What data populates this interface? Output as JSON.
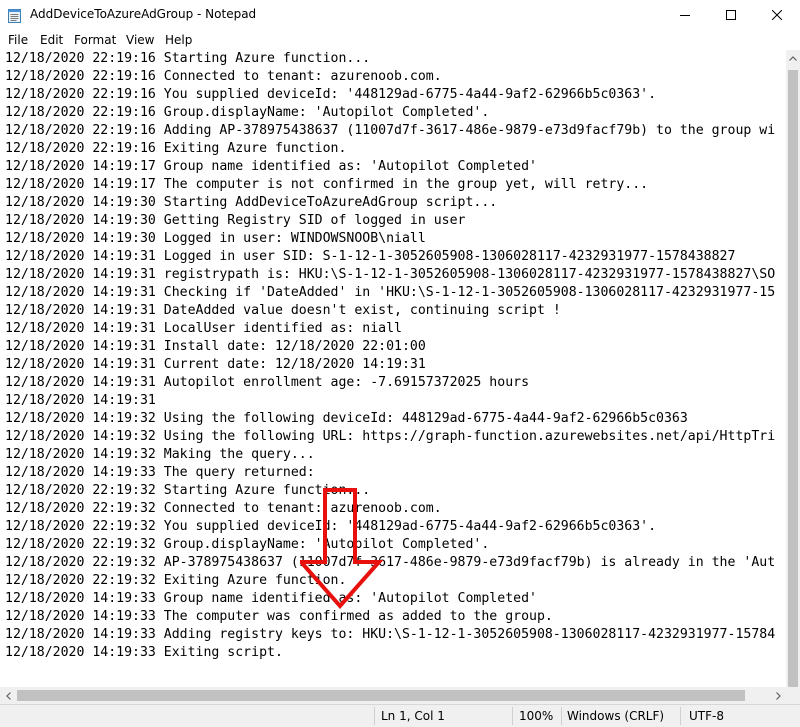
{
  "window": {
    "title": "AddDeviceToAzureAdGroup - Notepad",
    "icon": "notepad-icon",
    "controls": [
      "minimize-icon",
      "maximize-icon",
      "close-icon"
    ]
  },
  "menu": {
    "items": [
      "File",
      "Edit",
      "Format",
      "View",
      "Help"
    ]
  },
  "editor": {
    "lines": [
      "12/18/2020 22:19:16 Starting Azure function...",
      "12/18/2020 22:19:16 Connected to tenant: azurenoob.com.",
      "12/18/2020 22:19:16 You supplied deviceId: '448129ad-6775-4a44-9af2-62966b5c0363'.",
      "12/18/2020 22:19:16 Group.displayName: 'Autopilot Completed'.",
      "12/18/2020 22:19:16 Adding AP-378975438637 (11007d7f-3617-486e-9879-e73d9facf79b) to the group wi",
      "12/18/2020 22:19:16 Exiting Azure function.",
      "12/18/2020 14:19:17 Group name identified as: 'Autopilot Completed'",
      "12/18/2020 14:19:17 The computer is not confirmed in the group yet, will retry...",
      "12/18/2020 14:19:30 Starting AddDeviceToAzureAdGroup script...",
      "12/18/2020 14:19:30 Getting Registry SID of logged in user",
      "12/18/2020 14:19:30 Logged in user: WINDOWSNOOB\\niall",
      "12/18/2020 14:19:31 Logged in user SID: S-1-12-1-3052605908-1306028117-4232931977-1578438827",
      "12/18/2020 14:19:31 registrypath is: HKU:\\S-1-12-1-3052605908-1306028117-4232931977-1578438827\\SO",
      "12/18/2020 14:19:31 Checking if 'DateAdded' in 'HKU:\\S-1-12-1-3052605908-1306028117-4232931977-15",
      "12/18/2020 14:19:31 DateAdded value doesn't exist, continuing script !",
      "12/18/2020 14:19:31 LocalUser identified as: niall",
      "12/18/2020 14:19:31 Install date: 12/18/2020 22:01:00",
      "12/18/2020 14:19:31 Current date: 12/18/2020 14:19:31",
      "12/18/2020 14:19:31 Autopilot enrollment age: -7.69157372025 hours",
      "12/18/2020 14:19:31",
      "12/18/2020 14:19:32 Using the following deviceId: 448129ad-6775-4a44-9af2-62966b5c0363",
      "12/18/2020 14:19:32 Using the following URL: https://graph-function.azurewebsites.net/api/HttpTri",
      "12/18/2020 14:19:32 Making the query...",
      "12/18/2020 14:19:33 The query returned:",
      "12/18/2020 22:19:32 Starting Azure function...",
      "12/18/2020 22:19:32 Connected to tenant: azurenoob.com.",
      "12/18/2020 22:19:32 You supplied deviceId: '448129ad-6775-4a44-9af2-62966b5c0363'.",
      "12/18/2020 22:19:32 Group.displayName: 'Autopilot Completed'.",
      "12/18/2020 22:19:32 AP-378975438637 (11007d7f-3617-486e-9879-e73d9facf79b) is already in the 'Aut",
      "12/18/2020 22:19:32 Exiting Azure function.",
      "12/18/2020 14:19:33 Group name identified as: 'Autopilot Completed'",
      "12/18/2020 14:19:33 The computer was confirmed as added to the group.",
      "12/18/2020 14:19:33 Adding registry keys to: HKU:\\S-1-12-1-3052605908-1306028117-4232931977-15784",
      "12/18/2020 14:19:33 Exiting script."
    ],
    "annotation_color": "#e8100d"
  },
  "status": {
    "position": "Ln 1, Col 1",
    "zoom": "100%",
    "line_ending": "Windows (CRLF)",
    "encoding": "UTF-8"
  }
}
